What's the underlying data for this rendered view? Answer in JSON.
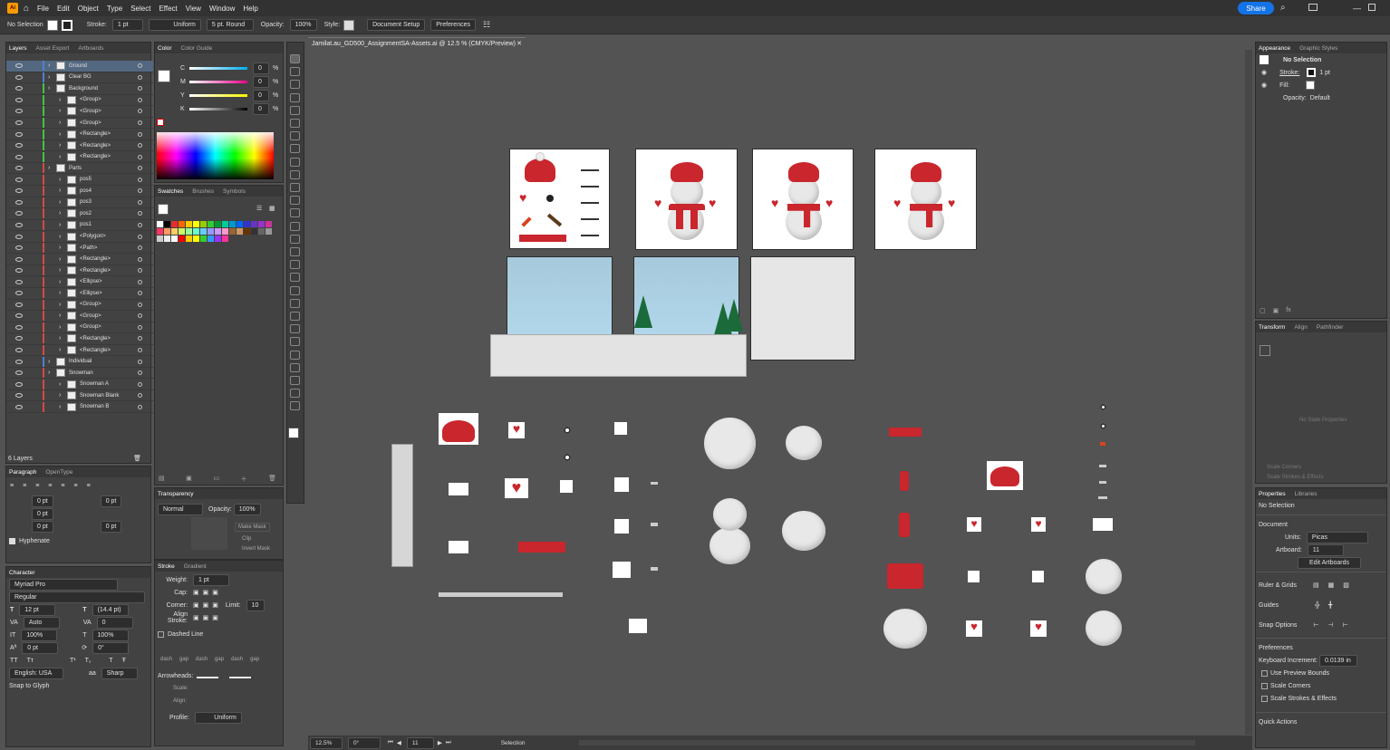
{
  "menubar": {
    "logo": "Ai",
    "items": [
      "File",
      "Edit",
      "Object",
      "Type",
      "Select",
      "Effect",
      "View",
      "Window",
      "Help"
    ],
    "share_label": "Share"
  },
  "control_bar": {
    "selection": "No Selection",
    "stroke_label": "Stroke:",
    "stroke_value": "1 pt",
    "profile": "Uniform",
    "brush": "5 pt. Round",
    "opacity_label": "Opacity:",
    "opacity_value": "100%",
    "style_label": "Style:",
    "document_setup": "Document Setup",
    "preferences": "Preferences"
  },
  "layers_panel": {
    "tabs": [
      "Layers",
      "Asset Export",
      "Artboards"
    ],
    "rows": [
      {
        "name": "Ground",
        "color": "#4f7fd9",
        "indent": 0
      },
      {
        "name": "Clear BG",
        "color": "#4f7fd9",
        "indent": 0
      },
      {
        "name": "Background",
        "color": "#42c442",
        "indent": 0
      },
      {
        "name": "<Group>",
        "color": "#42c442",
        "indent": 1
      },
      {
        "name": "<Group>",
        "color": "#42c442",
        "indent": 1
      },
      {
        "name": "<Group>",
        "color": "#42c442",
        "indent": 1
      },
      {
        "name": "<Rectangle>",
        "color": "#42c442",
        "indent": 1
      },
      {
        "name": "<Rectangle>",
        "color": "#42c442",
        "indent": 1
      },
      {
        "name": "<Rectangle>",
        "color": "#42c442",
        "indent": 1
      },
      {
        "name": "Parts",
        "color": "#d84747",
        "indent": 0
      },
      {
        "name": "pos5",
        "color": "#d84747",
        "indent": 1
      },
      {
        "name": "pos4",
        "color": "#d84747",
        "indent": 1
      },
      {
        "name": "pos3",
        "color": "#d84747",
        "indent": 1
      },
      {
        "name": "pos2",
        "color": "#d84747",
        "indent": 1
      },
      {
        "name": "pos1",
        "color": "#d84747",
        "indent": 1
      },
      {
        "name": "<Polygon>",
        "color": "#d84747",
        "indent": 1
      },
      {
        "name": "<Path>",
        "color": "#d84747",
        "indent": 1
      },
      {
        "name": "<Rectangle>",
        "color": "#d84747",
        "indent": 1
      },
      {
        "name": "<Rectangle>",
        "color": "#d84747",
        "indent": 1
      },
      {
        "name": "<Ellipse>",
        "color": "#d84747",
        "indent": 1
      },
      {
        "name": "<Ellipse>",
        "color": "#d84747",
        "indent": 1
      },
      {
        "name": "<Group>",
        "color": "#d84747",
        "indent": 1
      },
      {
        "name": "<Group>",
        "color": "#d84747",
        "indent": 1
      },
      {
        "name": "<Group>",
        "color": "#d84747",
        "indent": 1
      },
      {
        "name": "<Rectangle>",
        "color": "#d84747",
        "indent": 1
      },
      {
        "name": "<Rectangle>",
        "color": "#d84747",
        "indent": 1
      },
      {
        "name": "Individual",
        "color": "#4f7fd9",
        "indent": 0
      },
      {
        "name": "Snowman",
        "color": "#d84747",
        "indent": 0
      },
      {
        "name": "Snowman A",
        "color": "#d84747",
        "indent": 1
      },
      {
        "name": "Snowman Blank",
        "color": "#d84747",
        "indent": 1
      },
      {
        "name": "Snowman B",
        "color": "#d84747",
        "indent": 1
      }
    ],
    "footer": "6 Layers"
  },
  "paragraph_panel": {
    "tabs": [
      "Paragraph",
      "OpenType"
    ],
    "fields": [
      "0 pt",
      "0 pt",
      "0 pt",
      "0 pt",
      "0 pt"
    ],
    "hyphenate": "Hyphenate"
  },
  "character_panel": {
    "tab": "Character",
    "font": "Myriad Pro",
    "style": "Regular",
    "size": "12 pt",
    "leading": "(14.4 pt)",
    "kerning": "Auto",
    "tracking": "0",
    "vscale": "100%",
    "hscale": "100%",
    "baseline": "0 pt",
    "rotation": "0°",
    "language": "English: USA",
    "aa": "Sharp",
    "snap": "Snap to Glyph"
  },
  "color_panel": {
    "tabs": [
      "Color",
      "Color Guide"
    ],
    "channels": [
      {
        "label": "C",
        "value": "0",
        "unit": "%"
      },
      {
        "label": "M",
        "value": "0",
        "unit": "%"
      },
      {
        "label": "Y",
        "value": "0",
        "unit": "%"
      },
      {
        "label": "K",
        "value": "0",
        "unit": "%"
      }
    ]
  },
  "swatches_panel": {
    "tabs": [
      "Swatches",
      "Brushes",
      "Symbols"
    ],
    "colors": [
      "#ffffff",
      "#000000",
      "#e62e2e",
      "#ff6600",
      "#ffcc00",
      "#ffff00",
      "#99cc00",
      "#33cc33",
      "#009933",
      "#00cc99",
      "#0099cc",
      "#0066ff",
      "#3333cc",
      "#6633cc",
      "#9933cc",
      "#cc3399",
      "#ff3366",
      "#ff9966",
      "#ffcc66",
      "#ccff66",
      "#99ff99",
      "#66ffcc",
      "#66ccff",
      "#9999ff",
      "#cc99ff",
      "#ff99cc",
      "#996633",
      "#cc9966",
      "#663300",
      "#333333",
      "#666666",
      "#999999",
      "#cccccc",
      "#eeeeee",
      "#ffffff",
      "#ff0000",
      "#ffcc00",
      "#ffff00",
      "#33cc33",
      "#3399ff",
      "#9933ff",
      "#ff3399"
    ]
  },
  "transparency_panel": {
    "tab": "Transparency",
    "mode": "Normal",
    "opacity_label": "Opacity:",
    "opacity": "100%",
    "make_mask": "Make Mask",
    "clip": "Clip",
    "invert": "Invert Mask"
  },
  "stroke_panel": {
    "tabs": [
      "Stroke",
      "Gradient"
    ],
    "weight_label": "Weight:",
    "weight": "1 pt",
    "cap_label": "Cap:",
    "corner_label": "Corner:",
    "limit_label": "Limit:",
    "limit": "10",
    "align_label": "Align Stroke:",
    "dashed": "Dashed Line",
    "dash_fields": [
      "dash",
      "gap",
      "dash",
      "gap",
      "dash",
      "gap"
    ],
    "arrowheads": "Arrowheads:",
    "scale": "Scale:",
    "align": "Align:",
    "profile_label": "Profile:",
    "profile": "Uniform"
  },
  "document": {
    "tab_title": "Jamilat.au_GD500_AssignmentSA-Assets.ai @ 12.5 % (CMYK/Preview)",
    "zoom": "12.5%",
    "rotate": "0°",
    "artboard": "11",
    "status": "Selection"
  },
  "appearance_panel": {
    "tabs": [
      "Appearance",
      "Graphic Styles"
    ],
    "title": "No Selection",
    "stroke_label": "Stroke:",
    "stroke_value": "1 pt",
    "fill_label": "Fill:",
    "opacity_label": "Opacity:",
    "opacity_value": "Default"
  },
  "transform_panel": {
    "tabs": [
      "Transform",
      "Align",
      "Pathfinder"
    ],
    "no_state": "No State Properties",
    "scale_corners": "Scale Corners",
    "scale_strokes": "Scale Strokes & Effects"
  },
  "properties_panel": {
    "tabs": [
      "Properties",
      "Libraries"
    ],
    "title": "No Selection",
    "document_label": "Document",
    "units_label": "Units:",
    "units": "Picas",
    "artboard_label": "Artboard:",
    "artboard": "11",
    "edit_artboards": "Edit Artboards",
    "rulers": "Ruler & Grids",
    "guides": "Guides",
    "snap": "Snap Options",
    "preferences": "Preferences",
    "keyboard_label": "Keyboard Increment:",
    "keyboard_value": "0.0139 in",
    "preview_bounds": "Use Preview Bounds",
    "scale_corners": "Scale Corners",
    "scale_strokes": "Scale Strokes & Effects",
    "quick_actions": "Quick Actions"
  }
}
